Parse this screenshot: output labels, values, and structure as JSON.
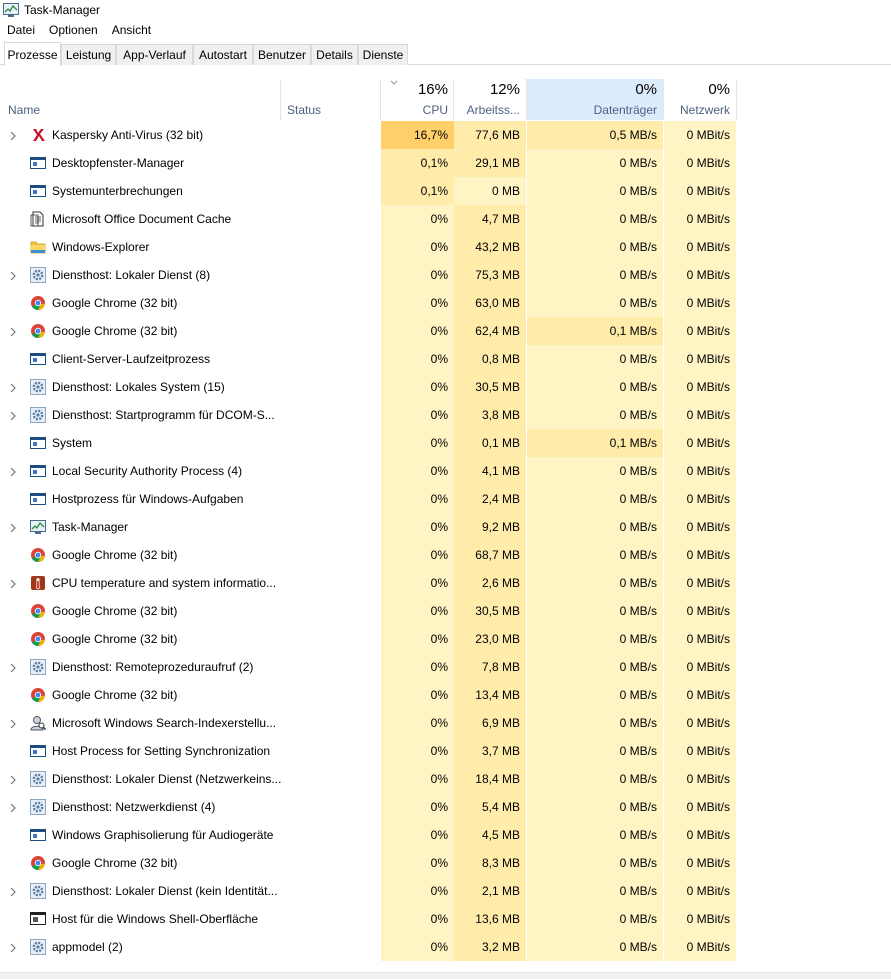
{
  "window": {
    "title": "Task-Manager"
  },
  "menu": [
    "Datei",
    "Optionen",
    "Ansicht"
  ],
  "tabs": [
    "Prozesse",
    "Leistung",
    "App-Verlauf",
    "Autostart",
    "Benutzer",
    "Details",
    "Dienste"
  ],
  "active_tab": "Prozesse",
  "columns": {
    "name": "Name",
    "status": "Status",
    "cpu": {
      "pct": "16%",
      "label": "CPU"
    },
    "memory": {
      "pct": "12%",
      "label": "Arbeitss..."
    },
    "disk": {
      "pct": "0%",
      "label": "Datenträger"
    },
    "network": {
      "pct": "0%",
      "label": "Netzwerk"
    }
  },
  "colors": {
    "heat_low": "#fff4c4",
    "heat_mid": "#ffecab",
    "heat_high": "#ffe08c",
    "heat_max": "#ffd06a",
    "header_accent": "#4d6082",
    "selected_column": "#dcecfc"
  },
  "processes": [
    {
      "name": "Kaspersky Anti-Virus (32 bit)",
      "icon": "kaspersky-icon",
      "expandable": true,
      "cpu": "16,7%",
      "mem": "77,6 MB",
      "disk": "0,5 MB/s",
      "net": "0 MBit/s",
      "cpu_heat": 3,
      "mem_heat": 1,
      "disk_heat": 1
    },
    {
      "name": "Desktopfenster-Manager",
      "icon": "window-app-icon",
      "expandable": false,
      "cpu": "0,1%",
      "mem": "29,1 MB",
      "disk": "0 MB/s",
      "net": "0 MBit/s",
      "cpu_heat": 1,
      "mem_heat": 1,
      "disk_heat": 0
    },
    {
      "name": "Systemunterbrechungen",
      "icon": "window-app-icon",
      "expandable": false,
      "cpu": "0,1%",
      "mem": "0 MB",
      "disk": "0 MB/s",
      "net": "0 MBit/s",
      "cpu_heat": 1,
      "mem_heat": 0,
      "disk_heat": 0
    },
    {
      "name": "Microsoft Office Document Cache",
      "icon": "document-icon",
      "expandable": false,
      "cpu": "0%",
      "mem": "4,7 MB",
      "disk": "0 MB/s",
      "net": "0 MBit/s",
      "cpu_heat": 0,
      "mem_heat": 1,
      "disk_heat": 0
    },
    {
      "name": "Windows-Explorer",
      "icon": "folder-icon",
      "expandable": false,
      "cpu": "0%",
      "mem": "43,2 MB",
      "disk": "0 MB/s",
      "net": "0 MBit/s",
      "cpu_heat": 0,
      "mem_heat": 1,
      "disk_heat": 0
    },
    {
      "name": "Diensthost: Lokaler Dienst (8)",
      "icon": "gear-icon",
      "expandable": true,
      "cpu": "0%",
      "mem": "75,3 MB",
      "disk": "0 MB/s",
      "net": "0 MBit/s",
      "cpu_heat": 0,
      "mem_heat": 1,
      "disk_heat": 0
    },
    {
      "name": "Google Chrome (32 bit)",
      "icon": "chrome-icon",
      "expandable": false,
      "cpu": "0%",
      "mem": "63,0 MB",
      "disk": "0 MB/s",
      "net": "0 MBit/s",
      "cpu_heat": 0,
      "mem_heat": 1,
      "disk_heat": 0
    },
    {
      "name": "Google Chrome (32 bit)",
      "icon": "chrome-icon",
      "expandable": true,
      "cpu": "0%",
      "mem": "62,4 MB",
      "disk": "0,1 MB/s",
      "net": "0 MBit/s",
      "cpu_heat": 0,
      "mem_heat": 1,
      "disk_heat": 1
    },
    {
      "name": "Client-Server-Laufzeitprozess",
      "icon": "window-app-icon",
      "expandable": false,
      "cpu": "0%",
      "mem": "0,8 MB",
      "disk": "0 MB/s",
      "net": "0 MBit/s",
      "cpu_heat": 0,
      "mem_heat": 1,
      "disk_heat": 0
    },
    {
      "name": "Diensthost: Lokales System (15)",
      "icon": "gear-icon",
      "expandable": true,
      "cpu": "0%",
      "mem": "30,5 MB",
      "disk": "0 MB/s",
      "net": "0 MBit/s",
      "cpu_heat": 0,
      "mem_heat": 1,
      "disk_heat": 0
    },
    {
      "name": "Diensthost: Startprogramm für DCOM-S...",
      "icon": "gear-icon",
      "expandable": true,
      "cpu": "0%",
      "mem": "3,8 MB",
      "disk": "0 MB/s",
      "net": "0 MBit/s",
      "cpu_heat": 0,
      "mem_heat": 1,
      "disk_heat": 0
    },
    {
      "name": "System",
      "icon": "window-app-icon",
      "expandable": false,
      "cpu": "0%",
      "mem": "0,1 MB",
      "disk": "0,1 MB/s",
      "net": "0 MBit/s",
      "cpu_heat": 0,
      "mem_heat": 1,
      "disk_heat": 1
    },
    {
      "name": "Local Security Authority Process (4)",
      "icon": "window-app-icon",
      "expandable": true,
      "cpu": "0%",
      "mem": "4,1 MB",
      "disk": "0 MB/s",
      "net": "0 MBit/s",
      "cpu_heat": 0,
      "mem_heat": 1,
      "disk_heat": 0
    },
    {
      "name": "Hostprozess für Windows-Aufgaben",
      "icon": "window-app-icon",
      "expandable": false,
      "cpu": "0%",
      "mem": "2,4 MB",
      "disk": "0 MB/s",
      "net": "0 MBit/s",
      "cpu_heat": 0,
      "mem_heat": 1,
      "disk_heat": 0
    },
    {
      "name": "Task-Manager",
      "icon": "task-manager-icon",
      "expandable": true,
      "cpu": "0%",
      "mem": "9,2 MB",
      "disk": "0 MB/s",
      "net": "0 MBit/s",
      "cpu_heat": 0,
      "mem_heat": 1,
      "disk_heat": 0
    },
    {
      "name": "Google Chrome (32 bit)",
      "icon": "chrome-icon",
      "expandable": false,
      "cpu": "0%",
      "mem": "68,7 MB",
      "disk": "0 MB/s",
      "net": "0 MBit/s",
      "cpu_heat": 0,
      "mem_heat": 1,
      "disk_heat": 0
    },
    {
      "name": "CPU temperature and system informatio...",
      "icon": "thermometer-icon",
      "expandable": true,
      "cpu": "0%",
      "mem": "2,6 MB",
      "disk": "0 MB/s",
      "net": "0 MBit/s",
      "cpu_heat": 0,
      "mem_heat": 1,
      "disk_heat": 0
    },
    {
      "name": "Google Chrome (32 bit)",
      "icon": "chrome-icon",
      "expandable": false,
      "cpu": "0%",
      "mem": "30,5 MB",
      "disk": "0 MB/s",
      "net": "0 MBit/s",
      "cpu_heat": 0,
      "mem_heat": 1,
      "disk_heat": 0
    },
    {
      "name": "Google Chrome (32 bit)",
      "icon": "chrome-icon",
      "expandable": false,
      "cpu": "0%",
      "mem": "23,0 MB",
      "disk": "0 MB/s",
      "net": "0 MBit/s",
      "cpu_heat": 0,
      "mem_heat": 1,
      "disk_heat": 0
    },
    {
      "name": "Diensthost: Remoteprozeduraufruf (2)",
      "icon": "gear-icon",
      "expandable": true,
      "cpu": "0%",
      "mem": "7,8 MB",
      "disk": "0 MB/s",
      "net": "0 MBit/s",
      "cpu_heat": 0,
      "mem_heat": 1,
      "disk_heat": 0
    },
    {
      "name": "Google Chrome (32 bit)",
      "icon": "chrome-icon",
      "expandable": false,
      "cpu": "0%",
      "mem": "13,4 MB",
      "disk": "0 MB/s",
      "net": "0 MBit/s",
      "cpu_heat": 0,
      "mem_heat": 1,
      "disk_heat": 0
    },
    {
      "name": "Microsoft Windows Search-Indexerstellu...",
      "icon": "search-indexer-icon",
      "expandable": true,
      "cpu": "0%",
      "mem": "6,9 MB",
      "disk": "0 MB/s",
      "net": "0 MBit/s",
      "cpu_heat": 0,
      "mem_heat": 1,
      "disk_heat": 0
    },
    {
      "name": "Host Process for Setting Synchronization",
      "icon": "window-app-icon",
      "expandable": false,
      "cpu": "0%",
      "mem": "3,7 MB",
      "disk": "0 MB/s",
      "net": "0 MBit/s",
      "cpu_heat": 0,
      "mem_heat": 1,
      "disk_heat": 0
    },
    {
      "name": "Diensthost: Lokaler Dienst (Netzwerkeins...",
      "icon": "gear-icon",
      "expandable": true,
      "cpu": "0%",
      "mem": "18,4 MB",
      "disk": "0 MB/s",
      "net": "0 MBit/s",
      "cpu_heat": 0,
      "mem_heat": 1,
      "disk_heat": 0
    },
    {
      "name": "Diensthost: Netzwerkdienst (4)",
      "icon": "gear-icon",
      "expandable": true,
      "cpu": "0%",
      "mem": "5,4 MB",
      "disk": "0 MB/s",
      "net": "0 MBit/s",
      "cpu_heat": 0,
      "mem_heat": 1,
      "disk_heat": 0
    },
    {
      "name": "Windows Graphisolierung für Audiogeräte",
      "icon": "window-app-icon",
      "expandable": false,
      "cpu": "0%",
      "mem": "4,5 MB",
      "disk": "0 MB/s",
      "net": "0 MBit/s",
      "cpu_heat": 0,
      "mem_heat": 1,
      "disk_heat": 0
    },
    {
      "name": "Google Chrome (32 bit)",
      "icon": "chrome-icon",
      "expandable": false,
      "cpu": "0%",
      "mem": "8,3 MB",
      "disk": "0 MB/s",
      "net": "0 MBit/s",
      "cpu_heat": 0,
      "mem_heat": 1,
      "disk_heat": 0
    },
    {
      "name": "Diensthost: Lokaler Dienst (kein Identität...",
      "icon": "gear-icon",
      "expandable": true,
      "cpu": "0%",
      "mem": "2,1 MB",
      "disk": "0 MB/s",
      "net": "0 MBit/s",
      "cpu_heat": 0,
      "mem_heat": 1,
      "disk_heat": 0
    },
    {
      "name": "Host für die Windows Shell-Oberfläche",
      "icon": "shell-host-icon",
      "expandable": false,
      "cpu": "0%",
      "mem": "13,6 MB",
      "disk": "0 MB/s",
      "net": "0 MBit/s",
      "cpu_heat": 0,
      "mem_heat": 1,
      "disk_heat": 0
    },
    {
      "name": "appmodel (2)",
      "icon": "gear-icon",
      "expandable": true,
      "cpu": "0%",
      "mem": "3,2 MB",
      "disk": "0 MB/s",
      "net": "0 MBit/s",
      "cpu_heat": 0,
      "mem_heat": 1,
      "disk_heat": 0
    }
  ]
}
